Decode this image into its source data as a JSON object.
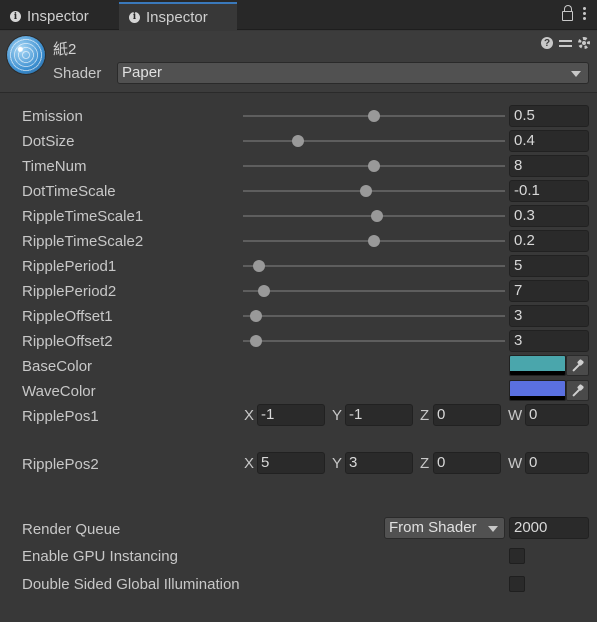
{
  "tabs": [
    {
      "label": "Inspector",
      "icon": "info-icon",
      "active": false
    },
    {
      "label": "Inspector",
      "icon": "info-icon",
      "active": true
    }
  ],
  "header": {
    "material_name": "紙2",
    "shader_label": "Shader",
    "shader_value": "Paper"
  },
  "properties": [
    {
      "label": "Emission",
      "value": "0.5",
      "slider": 0.5
    },
    {
      "label": "DotSize",
      "value": "0.4",
      "slider": 0.21
    },
    {
      "label": "TimeNum",
      "value": "8",
      "slider": 0.5
    },
    {
      "label": "DotTimeScale",
      "value": "-0.1",
      "slider": 0.47
    },
    {
      "label": "RippleTimeScale1",
      "value": "0.3",
      "slider": 0.51
    },
    {
      "label": "RippleTimeScale2",
      "value": "0.2",
      "slider": 0.5
    },
    {
      "label": "RipplePeriod1",
      "value": "5",
      "slider": 0.06
    },
    {
      "label": "RipplePeriod2",
      "value": "7",
      "slider": 0.08
    },
    {
      "label": "RippleOffset1",
      "value": "3",
      "slider": 0.05
    },
    {
      "label": "RippleOffset2",
      "value": "3",
      "slider": 0.05
    }
  ],
  "colors": [
    {
      "label": "BaseColor",
      "hex": "#4aa6ac"
    },
    {
      "label": "WaveColor",
      "hex": "#5a70e0"
    }
  ],
  "vectors": [
    {
      "label": "RipplePos1",
      "components": [
        {
          "axis": "X",
          "value": "-1"
        },
        {
          "axis": "Y",
          "value": "-1"
        },
        {
          "axis": "Z",
          "value": "0"
        },
        {
          "axis": "W",
          "value": "0"
        }
      ]
    },
    {
      "label": "RipplePos2",
      "components": [
        {
          "axis": "X",
          "value": "5"
        },
        {
          "axis": "Y",
          "value": "3"
        },
        {
          "axis": "Z",
          "value": "0"
        },
        {
          "axis": "W",
          "value": "0"
        }
      ]
    }
  ],
  "render_queue": {
    "label": "Render Queue",
    "mode": "From Shader",
    "value": "2000"
  },
  "options": [
    {
      "label": "Enable GPU Instancing",
      "checked": false
    },
    {
      "label": "Double Sided Global Illumination",
      "checked": false
    }
  ],
  "theme": {
    "accent": "#3a79bb",
    "background": "#383838"
  }
}
